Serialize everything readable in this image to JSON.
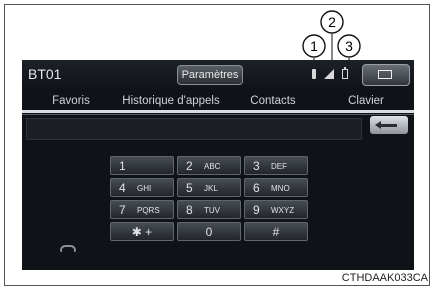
{
  "callouts": [
    "1",
    "2",
    "3"
  ],
  "statusbar": {
    "device_name": "BT01",
    "title": "Paramètres",
    "icons": [
      "bluetooth-connection-icon",
      "signal-strength-icon",
      "battery-icon",
      "message-icon"
    ]
  },
  "tabs": [
    "Favoris",
    "Historique d'appels",
    "Contacts",
    "Clavier"
  ],
  "keypad": {
    "keys": [
      {
        "digit": "1",
        "letters": ""
      },
      {
        "digit": "2",
        "letters": "ABC"
      },
      {
        "digit": "3",
        "letters": "DEF"
      },
      {
        "digit": "4",
        "letters": "GHI"
      },
      {
        "digit": "5",
        "letters": "JKL"
      },
      {
        "digit": "6",
        "letters": "MNO"
      },
      {
        "digit": "7",
        "letters": "PQRS"
      },
      {
        "digit": "8",
        "letters": "TUV"
      },
      {
        "digit": "9",
        "letters": "WXYZ"
      },
      {
        "digit": "✱ +",
        "letters": ""
      },
      {
        "digit": "0",
        "letters": ""
      },
      {
        "digit": "#",
        "letters": ""
      }
    ],
    "backspace_icon": "backspace-arrow-icon",
    "call_icon": "handset-call-icon"
  },
  "caption": "CTHDAAK033CA"
}
